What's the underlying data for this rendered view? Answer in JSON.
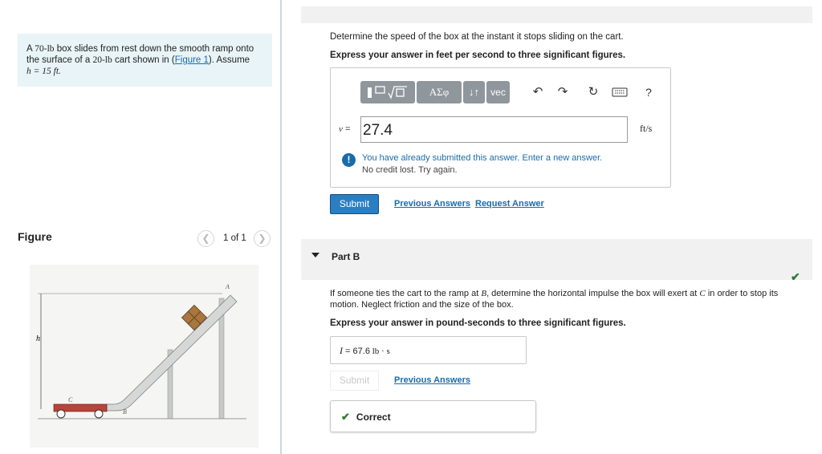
{
  "problem": {
    "text_before_weight": "A ",
    "weight_box": "70-lb",
    "text_mid1": " box slides from rest down the smooth ramp onto the surface of a ",
    "weight_cart": "20-lb",
    "text_mid2": " cart shown in (",
    "figure_link": "Figure 1",
    "text_mid3": "). Assume ",
    "assumption": "h = 15 ft."
  },
  "figure": {
    "label": "Figure",
    "counter": "1 of 1",
    "prev_icon": "chevron-left-icon",
    "next_icon": "chevron-right-icon",
    "point_labels": {
      "a": "A",
      "b": "B",
      "c": "C",
      "h": "h"
    }
  },
  "part_a": {
    "question": "Determine the speed of the box at the instant it stops sliding on the cart.",
    "instruction": "Express your answer in feet per second to three significant figures.",
    "toolbar": {
      "greek_label": "ΑΣφ",
      "arrows_label": "↓↑",
      "vec_label": "vec",
      "help_label": "?"
    },
    "variable_label": "v",
    "equals": " =",
    "answer_value": "27.4",
    "unit": "ft/s",
    "warning_line1": "You have already submitted this answer. Enter a new answer.",
    "warning_line2": "No credit lost. Try again.",
    "submit_label": "Submit",
    "previous_answers_label": "Previous Answers",
    "request_answer_label": "Request Answer"
  },
  "part_b": {
    "title": "Part B",
    "question_part1": "If someone ties the cart to the ramp at ",
    "point_b": "B",
    "question_part2": ", determine the horizontal impulse the box will exert at ",
    "point_c": "C",
    "question_part3": " in order to stop its",
    "question_line2": "motion. Neglect friction and the size of the box.",
    "instruction": "Express your answer in pound-seconds to three significant figures.",
    "answer_variable": "I",
    "answer_equals": " = ",
    "answer_value": "67.6",
    "answer_unit": " lb · s",
    "submit_label": "Submit",
    "previous_answers_label": "Previous Answers",
    "correct_label": "Correct"
  },
  "colors": {
    "link": "#1a6ca8",
    "submit_bg": "#2a7ec1",
    "correct": "#2e7d32",
    "problem_bg": "#e8f4f7",
    "toolbar_btn": "#8f969c"
  }
}
